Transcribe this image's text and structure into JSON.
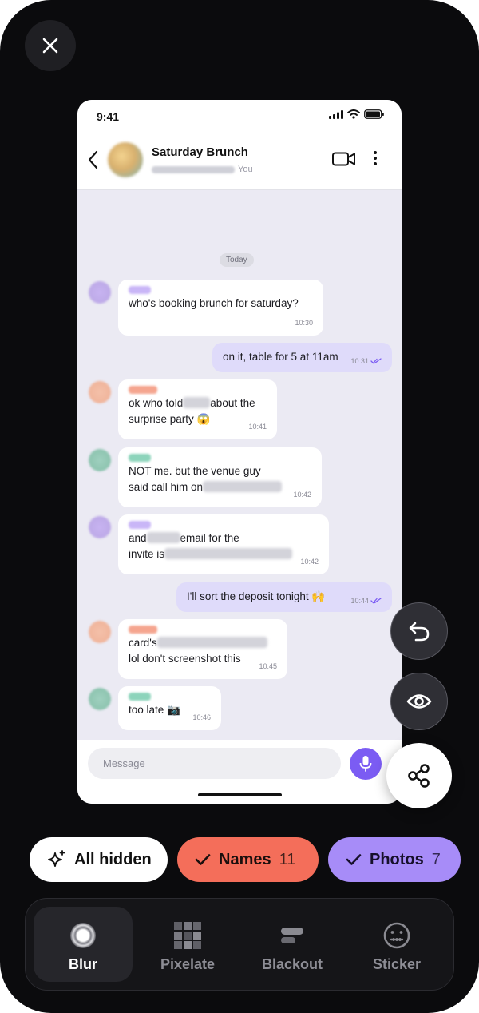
{
  "status": {
    "time": "9:41"
  },
  "header": {
    "title": "Saturday Brunch",
    "subtitle_suffix": "You"
  },
  "chat": {
    "date_label": "Today",
    "messages": [
      {
        "dir": "in",
        "lines": [
          "who's booking brunch for saturday?"
        ],
        "time": "10:30"
      },
      {
        "dir": "out",
        "lines": [
          "on it, table for 5 at 11am"
        ],
        "time": "10:31"
      },
      {
        "dir": "in",
        "line1_a": "ok who told",
        "line1_b": "about the",
        "line2": "surprise party 😱",
        "time": "10:41"
      },
      {
        "dir": "in",
        "line1": "NOT me. but the venue guy",
        "line2": "said call him on",
        "time": "10:42"
      },
      {
        "dir": "in",
        "line1_a": "and",
        "line1_b": "email for the",
        "line2": "invite is",
        "time": "10:42"
      },
      {
        "dir": "out",
        "lines": [
          "I'll sort the deposit tonight 🙌"
        ],
        "time": "10:44"
      },
      {
        "dir": "in",
        "line1": "card's",
        "line2": "lol don't screenshot this",
        "time": "10:45"
      },
      {
        "dir": "in",
        "line1": "too late 📷",
        "time": "10:46"
      }
    ],
    "composer_placeholder": "Message"
  },
  "chips": {
    "hidden": {
      "label": "All hidden"
    },
    "names": {
      "label": "Names",
      "count": "11"
    },
    "photos": {
      "label": "Photos",
      "count": "7"
    }
  },
  "tools": {
    "blur": "Blur",
    "pixelate": "Pixelate",
    "blackout": "Blackout",
    "sticker": "Sticker"
  },
  "colors": {
    "accent_purple": "#7b5cf3",
    "names_chip": "#f46e5a",
    "photos_chip": "#a78cf8",
    "outgoing_bubble": "#dfdbfa",
    "chat_bg": "#ebeaf3"
  },
  "icons": [
    "close-icon",
    "back-chevron-icon",
    "video-icon",
    "more-vertical-icon",
    "mic-icon",
    "undo-icon",
    "eye-icon",
    "share-icon",
    "sparkle-icon",
    "check-icon",
    "blur-icon",
    "pixelate-icon",
    "blackout-icon",
    "sticker-icon"
  ]
}
